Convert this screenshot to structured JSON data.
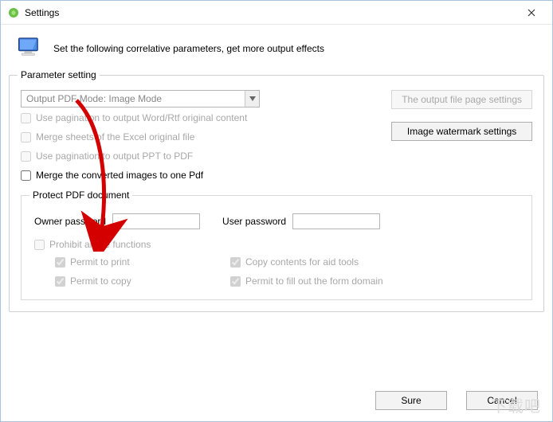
{
  "window": {
    "title": "Settings"
  },
  "header": {
    "text": "Set the following correlative parameters, get more output effects"
  },
  "group": {
    "legend": "Parameter setting",
    "combo_label": "Output PDF Mode: Image Mode",
    "btn_page_settings": "The output file page settings",
    "btn_watermark": "Image watermark settings",
    "checks": {
      "pagination_word": "Use pagination to output Word/Rtf original content",
      "merge_excel": "Merge sheets of the Excel original file",
      "pagination_ppt": "Use pagination to output PPT to PDF",
      "merge_images": "Merge the converted images to one Pdf"
    },
    "protect": {
      "legend": "Protect PDF document",
      "owner_label": "Owner password",
      "user_label": "User password",
      "prohibit": "Prohibit all the functions",
      "permit_print": "Permit to print",
      "permit_copy": "Permit to copy",
      "copy_aid": "Copy contents for aid tools",
      "permit_form": "Permit to fill out the form domain"
    }
  },
  "footer": {
    "sure": "Sure",
    "cancel": "Cancel"
  },
  "watermark": "下载吧"
}
